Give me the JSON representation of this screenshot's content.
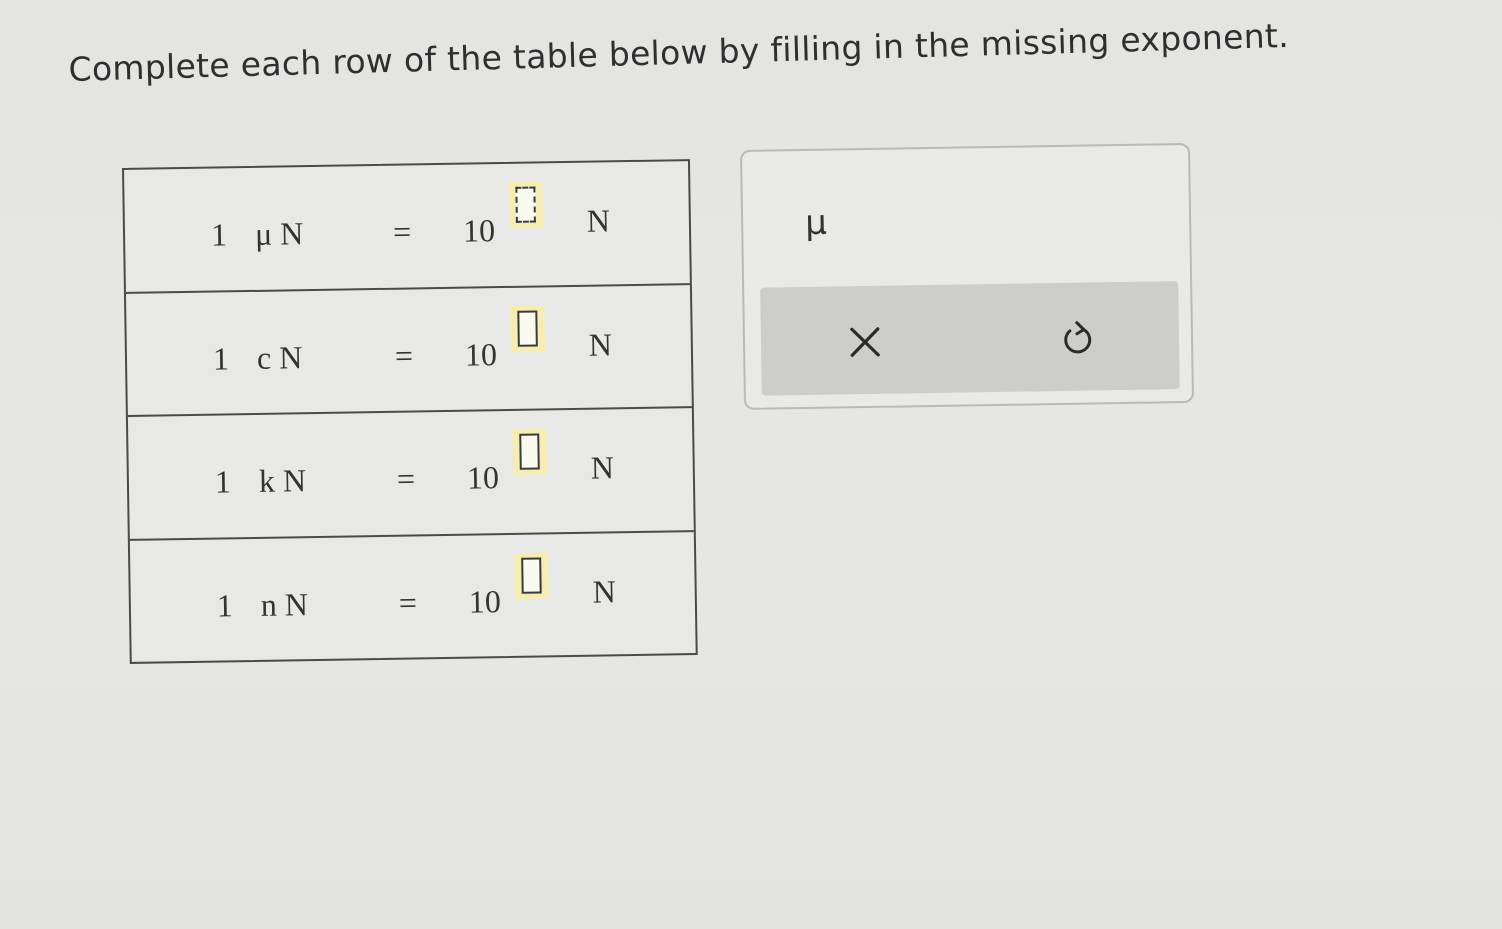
{
  "instruction": "Complete each row of the table below by filling in the missing exponent.",
  "table": {
    "rows": [
      {
        "one": "1",
        "prefix_unit": "μ N",
        "equals": "=",
        "base": "10",
        "exponent": "",
        "unit": "N"
      },
      {
        "one": "1",
        "prefix_unit": "c N",
        "equals": "=",
        "base": "10",
        "exponent": "",
        "unit": "N"
      },
      {
        "one": "1",
        "prefix_unit": "k N",
        "equals": "=",
        "base": "10",
        "exponent": "",
        "unit": "N"
      },
      {
        "one": "1",
        "prefix_unit": "n N",
        "equals": "=",
        "base": "10",
        "exponent": "",
        "unit": "N"
      }
    ]
  },
  "palette": {
    "key_mu": "μ",
    "clear_icon": "close-icon",
    "undo_icon": "undo-icon"
  },
  "colors": {
    "answer_highlight": "#f6edb1",
    "action_bar": "#cdcdcb"
  }
}
